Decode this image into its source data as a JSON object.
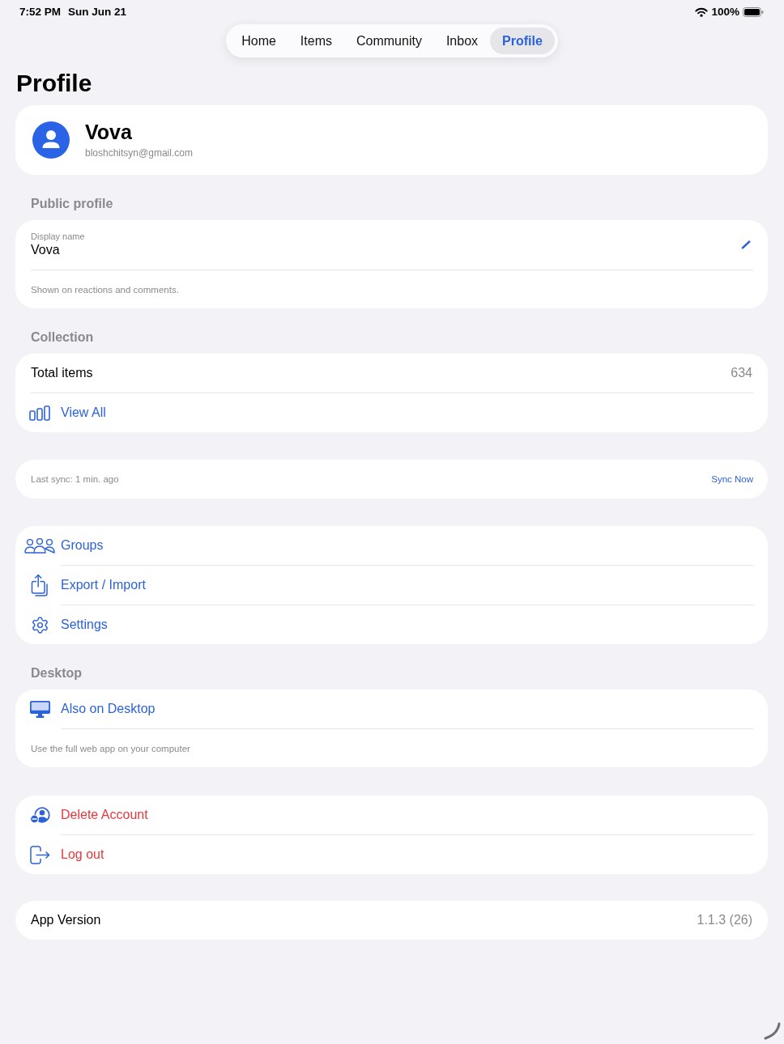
{
  "status_bar": {
    "time": "7:52 PM",
    "date": "Sun Jun 21",
    "battery": "100%"
  },
  "tabs": [
    {
      "label": "Home",
      "selected": false
    },
    {
      "label": "Items",
      "selected": false
    },
    {
      "label": "Community",
      "selected": false
    },
    {
      "label": "Inbox",
      "selected": false
    },
    {
      "label": "Profile",
      "selected": true
    }
  ],
  "page_title": "Profile",
  "account": {
    "name": "Vova",
    "email": "bloshchitsyn@gmail.com"
  },
  "public_profile": {
    "header": "Public profile",
    "field_label": "Display name",
    "field_value": "Vova",
    "note": "Shown on reactions and comments."
  },
  "collection": {
    "header": "Collection",
    "total_label": "Total items",
    "total_value": "634",
    "link": "View All"
  },
  "sync": {
    "status": "Last sync: 1 min. ago",
    "action": "Sync Now"
  },
  "menu": [
    "Groups",
    "Export / Import",
    "Settings"
  ],
  "desktop": {
    "header": "Desktop",
    "link": "Also on Desktop",
    "note": "Use the full web app on your computer"
  },
  "account_actions": [
    "Delete Account",
    "Log out"
  ],
  "app_version": {
    "label": "App Version",
    "value": "1.1.3 (26)"
  }
}
